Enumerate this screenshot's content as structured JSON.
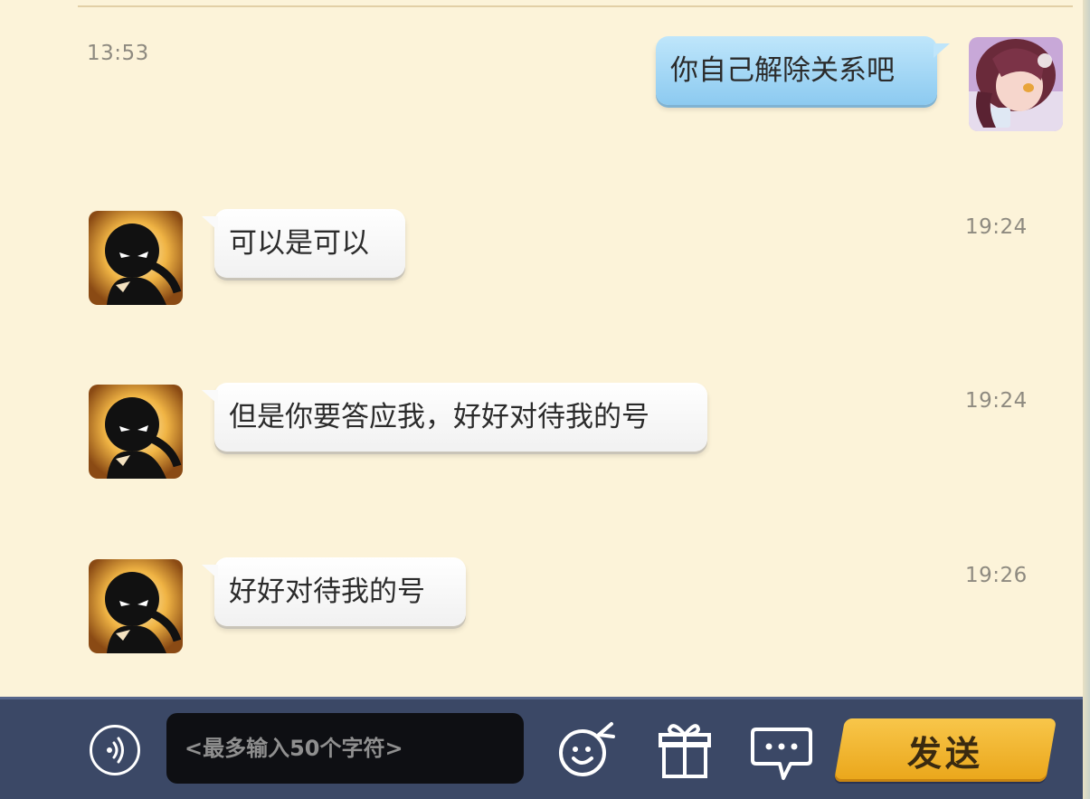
{
  "messages": [
    {
      "side": "right",
      "text": "你自己解除关系吧",
      "time": "13:53",
      "avatar": "anime-girl-avatar"
    },
    {
      "side": "left",
      "text": "可以是可以",
      "time": "19:24",
      "avatar": "shadow-ninja-avatar"
    },
    {
      "side": "left",
      "text": "但是你要答应我，好好对待我的号",
      "time": "19:24",
      "avatar": "shadow-ninja-avatar"
    },
    {
      "side": "left",
      "text": "好好对待我的号",
      "time": "19:26",
      "avatar": "shadow-ninja-avatar"
    }
  ],
  "input": {
    "placeholder": "<最多输入50个字符>",
    "value": ""
  },
  "buttons": {
    "send_label": "发送",
    "voice_icon": "voice-icon",
    "emoji_icon": "emoji-icon",
    "gift_icon": "gift-icon",
    "more_icon": "chat-bubble-icon"
  },
  "colors": {
    "chat_background": "#fcf3d9",
    "bottom_bar": "#3b4866",
    "send_button": "#f2b52e",
    "my_bubble": "#a8d9f6",
    "their_bubble": "#ffffff"
  }
}
